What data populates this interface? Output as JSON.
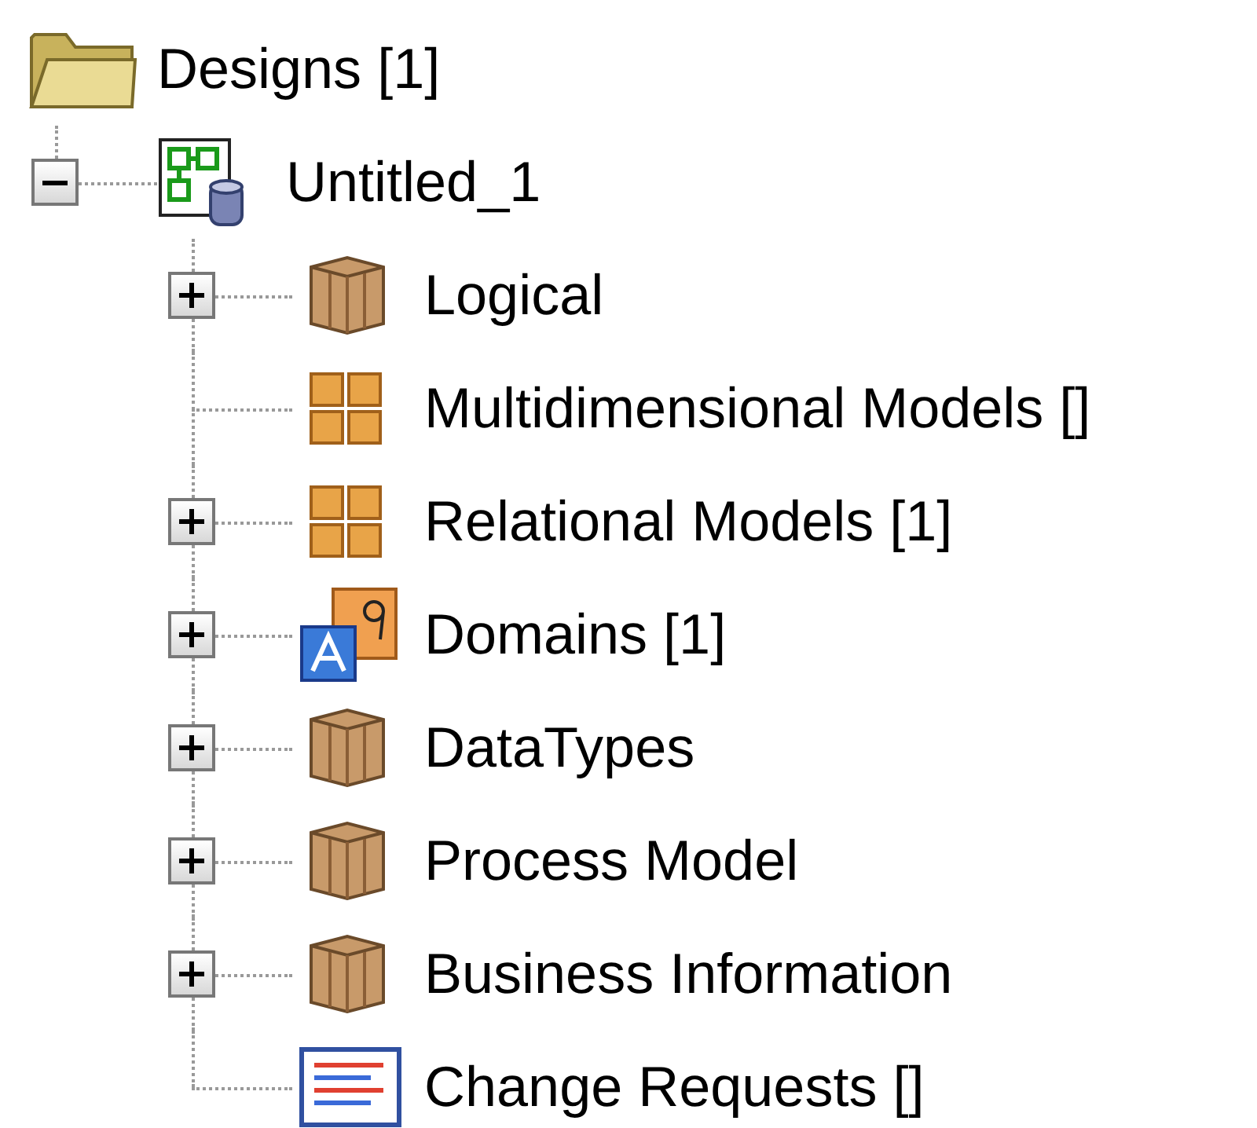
{
  "tree": {
    "label": "Designs [1]",
    "kind": "folder",
    "children": [
      {
        "label": "Untitled_1",
        "kind": "design",
        "expanded": true,
        "children": [
          {
            "label": "Logical",
            "kind": "package",
            "expanded": false
          },
          {
            "label": "Multidimensional Models []",
            "kind": "grid"
          },
          {
            "label": "Relational Models [1]",
            "kind": "grid",
            "expanded": false
          },
          {
            "label": "Domains [1]",
            "kind": "domains",
            "expanded": false
          },
          {
            "label": "DataTypes",
            "kind": "package",
            "expanded": false
          },
          {
            "label": "Process Model",
            "kind": "package",
            "expanded": false
          },
          {
            "label": "Business Information",
            "kind": "package",
            "expanded": false
          },
          {
            "label": "Change Requests []",
            "kind": "list"
          }
        ]
      }
    ]
  }
}
